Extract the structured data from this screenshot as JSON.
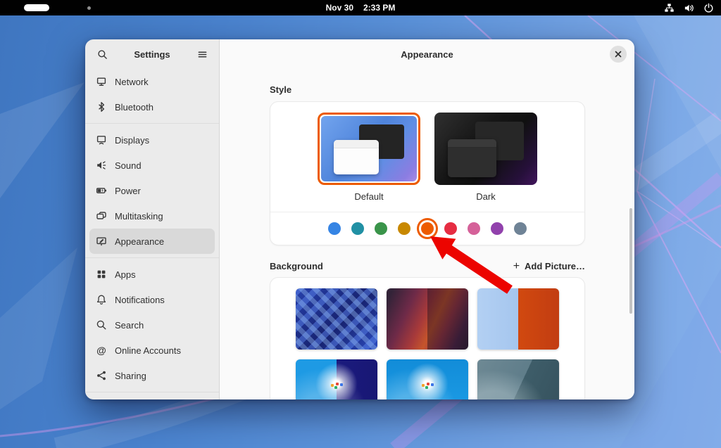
{
  "topbar": {
    "date": "Nov 30",
    "time": "2:33 PM"
  },
  "settings": {
    "title": "Settings",
    "sidebar_items": [
      {
        "label": "Network"
      },
      {
        "label": "Bluetooth"
      },
      {
        "label": "Displays"
      },
      {
        "label": "Sound"
      },
      {
        "label": "Power"
      },
      {
        "label": "Multitasking"
      },
      {
        "label": "Appearance",
        "selected": true
      },
      {
        "label": "Apps"
      },
      {
        "label": "Notifications"
      },
      {
        "label": "Search"
      },
      {
        "label": "Online Accounts"
      },
      {
        "label": "Sharing"
      }
    ],
    "panel": {
      "title": "Appearance",
      "style_section": {
        "label": "Style",
        "options": [
          {
            "label": "Default",
            "selected": true
          },
          {
            "label": "Dark",
            "selected": false
          }
        ],
        "accent_colors": [
          {
            "name": "blue",
            "color": "#3584e4",
            "selected": false
          },
          {
            "name": "teal",
            "color": "#2190a4",
            "selected": false
          },
          {
            "name": "green",
            "color": "#3a944a",
            "selected": false
          },
          {
            "name": "yellow",
            "color": "#c88800",
            "selected": false
          },
          {
            "name": "orange",
            "color": "#ed5b00",
            "selected": true
          },
          {
            "name": "red",
            "color": "#e62d42",
            "selected": false
          },
          {
            "name": "pink",
            "color": "#d56199",
            "selected": false
          },
          {
            "name": "purple",
            "color": "#9141ac",
            "selected": false
          },
          {
            "name": "slate",
            "color": "#6f8396",
            "selected": false
          }
        ]
      },
      "background_section": {
        "label": "Background",
        "add_button": {
          "plus": "+",
          "label": "Add Picture…"
        },
        "wallpapers": [
          "blue-triangles-mosaic",
          "red-purple-waves",
          "blue-orange-split",
          "island-day-night",
          "island-day",
          "teal-abstract"
        ]
      }
    }
  }
}
